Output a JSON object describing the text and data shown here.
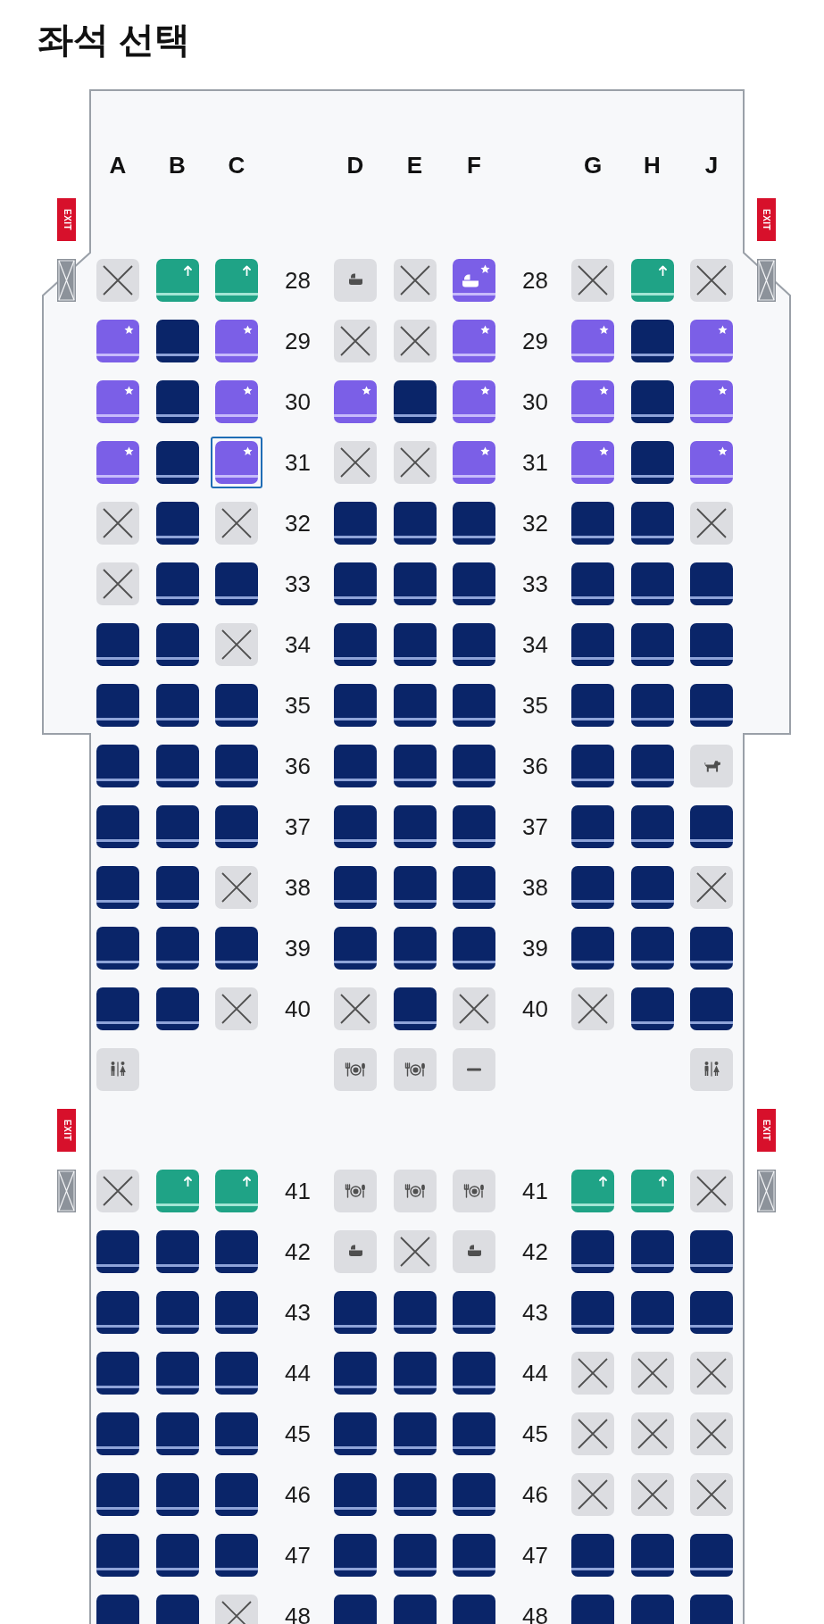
{
  "title": "좌석 선택",
  "cabin": {
    "columns": [
      "A",
      "B",
      "C",
      "D",
      "E",
      "F",
      "G",
      "H",
      "J"
    ],
    "rows": [
      {
        "kind": "exit",
        "signs": [
          "EXIT",
          "EXIT"
        ]
      },
      {
        "kind": "seats",
        "doors": true,
        "labels": [
          "28",
          "28"
        ],
        "seats": [
          {
            "kind": "blocked",
            "selected": false
          },
          {
            "kind": "extra_legroom",
            "selected": false
          },
          {
            "kind": "extra_legroom",
            "selected": false
          },
          {
            "kind": "bassinet"
          },
          {
            "kind": "blocked",
            "selected": false
          },
          {
            "kind": "preferred_bassinet",
            "selected": false
          },
          {
            "kind": "blocked",
            "selected": false
          },
          {
            "kind": "extra_legroom",
            "selected": false
          },
          {
            "kind": "blocked",
            "selected": false
          }
        ]
      },
      {
        "kind": "seats",
        "labels": [
          "29",
          "29"
        ],
        "seats": [
          {
            "kind": "preferred",
            "selected": false
          },
          {
            "kind": "available",
            "selected": false
          },
          {
            "kind": "preferred",
            "selected": false
          },
          {
            "kind": "blocked",
            "selected": false
          },
          {
            "kind": "blocked",
            "selected": false
          },
          {
            "kind": "preferred",
            "selected": false
          },
          {
            "kind": "preferred",
            "selected": false
          },
          {
            "kind": "available",
            "selected": false
          },
          {
            "kind": "preferred",
            "selected": false
          }
        ]
      },
      {
        "kind": "seats",
        "labels": [
          "30",
          "30"
        ],
        "seats": [
          {
            "kind": "preferred",
            "selected": false
          },
          {
            "kind": "available",
            "selected": false
          },
          {
            "kind": "preferred",
            "selected": false
          },
          {
            "kind": "preferred",
            "selected": false
          },
          {
            "kind": "available",
            "selected": false
          },
          {
            "kind": "preferred",
            "selected": false
          },
          {
            "kind": "preferred",
            "selected": false
          },
          {
            "kind": "available",
            "selected": false
          },
          {
            "kind": "preferred",
            "selected": false
          }
        ]
      },
      {
        "kind": "seats",
        "labels": [
          "31",
          "31"
        ],
        "seats": [
          {
            "kind": "preferred",
            "selected": false
          },
          {
            "kind": "available",
            "selected": false
          },
          {
            "kind": "preferred",
            "selected": true
          },
          {
            "kind": "blocked",
            "selected": false
          },
          {
            "kind": "blocked",
            "selected": false
          },
          {
            "kind": "preferred",
            "selected": false
          },
          {
            "kind": "preferred",
            "selected": false
          },
          {
            "kind": "available",
            "selected": false
          },
          {
            "kind": "preferred",
            "selected": false
          }
        ]
      },
      {
        "kind": "seats",
        "labels": [
          "32",
          "32"
        ],
        "seats": [
          {
            "kind": "blocked",
            "selected": false
          },
          {
            "kind": "available",
            "selected": false
          },
          {
            "kind": "blocked",
            "selected": false
          },
          {
            "kind": "available",
            "selected": false
          },
          {
            "kind": "available",
            "selected": false
          },
          {
            "kind": "available",
            "selected": false
          },
          {
            "kind": "available",
            "selected": false
          },
          {
            "kind": "available",
            "selected": false
          },
          {
            "kind": "blocked",
            "selected": false
          }
        ]
      },
      {
        "kind": "seats",
        "labels": [
          "33",
          "33"
        ],
        "seats": [
          {
            "kind": "blocked",
            "selected": false
          },
          {
            "kind": "available",
            "selected": false
          },
          {
            "kind": "available",
            "selected": false
          },
          {
            "kind": "available",
            "selected": false
          },
          {
            "kind": "available",
            "selected": false
          },
          {
            "kind": "available",
            "selected": false
          },
          {
            "kind": "available",
            "selected": false
          },
          {
            "kind": "available",
            "selected": false
          },
          {
            "kind": "available",
            "selected": false
          }
        ]
      },
      {
        "kind": "seats",
        "labels": [
          "34",
          "34"
        ],
        "seats": [
          {
            "kind": "available",
            "selected": false
          },
          {
            "kind": "available",
            "selected": false
          },
          {
            "kind": "blocked",
            "selected": false
          },
          {
            "kind": "available",
            "selected": false
          },
          {
            "kind": "available",
            "selected": false
          },
          {
            "kind": "available",
            "selected": false
          },
          {
            "kind": "available",
            "selected": false
          },
          {
            "kind": "available",
            "selected": false
          },
          {
            "kind": "available",
            "selected": false
          }
        ]
      },
      {
        "kind": "seats",
        "labels": [
          "35",
          "35"
        ],
        "seats": [
          {
            "kind": "available",
            "selected": false
          },
          {
            "kind": "available",
            "selected": false
          },
          {
            "kind": "available",
            "selected": false
          },
          {
            "kind": "available",
            "selected": false
          },
          {
            "kind": "available",
            "selected": false
          },
          {
            "kind": "available",
            "selected": false
          },
          {
            "kind": "available",
            "selected": false
          },
          {
            "kind": "available",
            "selected": false
          },
          {
            "kind": "available",
            "selected": false
          }
        ]
      },
      {
        "kind": "seats",
        "labels": [
          "36",
          "36"
        ],
        "seats": [
          {
            "kind": "available",
            "selected": false
          },
          {
            "kind": "available",
            "selected": false
          },
          {
            "kind": "available",
            "selected": false
          },
          {
            "kind": "available",
            "selected": false
          },
          {
            "kind": "available",
            "selected": false
          },
          {
            "kind": "available",
            "selected": false
          },
          {
            "kind": "available",
            "selected": false
          },
          {
            "kind": "available",
            "selected": false
          },
          {
            "kind": "pet"
          }
        ]
      },
      {
        "kind": "seats",
        "labels": [
          "37",
          "37"
        ],
        "seats": [
          {
            "kind": "available",
            "selected": false
          },
          {
            "kind": "available",
            "selected": false
          },
          {
            "kind": "available",
            "selected": false
          },
          {
            "kind": "available",
            "selected": false
          },
          {
            "kind": "available",
            "selected": false
          },
          {
            "kind": "available",
            "selected": false
          },
          {
            "kind": "available",
            "selected": false
          },
          {
            "kind": "available",
            "selected": false
          },
          {
            "kind": "available",
            "selected": false
          }
        ]
      },
      {
        "kind": "seats",
        "labels": [
          "38",
          "38"
        ],
        "seats": [
          {
            "kind": "available",
            "selected": false
          },
          {
            "kind": "available",
            "selected": false
          },
          {
            "kind": "blocked",
            "selected": false
          },
          {
            "kind": "available",
            "selected": false
          },
          {
            "kind": "available",
            "selected": false
          },
          {
            "kind": "available",
            "selected": false
          },
          {
            "kind": "available",
            "selected": false
          },
          {
            "kind": "available",
            "selected": false
          },
          {
            "kind": "blocked",
            "selected": false
          }
        ]
      },
      {
        "kind": "seats",
        "labels": [
          "39",
          "39"
        ],
        "seats": [
          {
            "kind": "available",
            "selected": false
          },
          {
            "kind": "available",
            "selected": false
          },
          {
            "kind": "available",
            "selected": false
          },
          {
            "kind": "available",
            "selected": false
          },
          {
            "kind": "available",
            "selected": false
          },
          {
            "kind": "available",
            "selected": false
          },
          {
            "kind": "available",
            "selected": false
          },
          {
            "kind": "available",
            "selected": false
          },
          {
            "kind": "available",
            "selected": false
          }
        ]
      },
      {
        "kind": "seats",
        "labels": [
          "40",
          "40"
        ],
        "seats": [
          {
            "kind": "available",
            "selected": false
          },
          {
            "kind": "available",
            "selected": false
          },
          {
            "kind": "blocked",
            "selected": false
          },
          {
            "kind": "blocked",
            "selected": false
          },
          {
            "kind": "available",
            "selected": false
          },
          {
            "kind": "blocked",
            "selected": false
          },
          {
            "kind": "blocked",
            "selected": false
          },
          {
            "kind": "available",
            "selected": false
          },
          {
            "kind": "available",
            "selected": false
          }
        ]
      },
      {
        "kind": "facilities",
        "cells": [
          {
            "kind": "lavatory"
          },
          {
            "kind": "empty"
          },
          {
            "kind": "empty"
          },
          {
            "kind": "galley"
          },
          {
            "kind": "galley"
          },
          {
            "kind": "closed"
          },
          {
            "kind": "empty"
          },
          {
            "kind": "empty"
          },
          {
            "kind": "lavatory"
          }
        ]
      },
      {
        "kind": "exit",
        "signs": [
          "EXIT",
          "EXIT"
        ]
      },
      {
        "kind": "seats",
        "doors": true,
        "labels": [
          "41",
          "41"
        ],
        "seats": [
          {
            "kind": "blocked",
            "selected": false
          },
          {
            "kind": "extra_legroom",
            "selected": false
          },
          {
            "kind": "extra_legroom",
            "selected": false
          },
          {
            "kind": "galley"
          },
          {
            "kind": "galley"
          },
          {
            "kind": "galley"
          },
          {
            "kind": "extra_legroom",
            "selected": false
          },
          {
            "kind": "extra_legroom",
            "selected": false
          },
          {
            "kind": "blocked",
            "selected": false
          }
        ]
      },
      {
        "kind": "seats",
        "labels": [
          "42",
          "42"
        ],
        "seats": [
          {
            "kind": "available",
            "selected": false
          },
          {
            "kind": "available",
            "selected": false
          },
          {
            "kind": "available",
            "selected": false
          },
          {
            "kind": "bassinet"
          },
          {
            "kind": "blocked",
            "selected": false
          },
          {
            "kind": "bassinet"
          },
          {
            "kind": "available",
            "selected": false
          },
          {
            "kind": "available",
            "selected": false
          },
          {
            "kind": "available",
            "selected": false
          }
        ]
      },
      {
        "kind": "seats",
        "labels": [
          "43",
          "43"
        ],
        "seats": [
          {
            "kind": "available",
            "selected": false
          },
          {
            "kind": "available",
            "selected": false
          },
          {
            "kind": "available",
            "selected": false
          },
          {
            "kind": "available",
            "selected": false
          },
          {
            "kind": "available",
            "selected": false
          },
          {
            "kind": "available",
            "selected": false
          },
          {
            "kind": "available",
            "selected": false
          },
          {
            "kind": "available",
            "selected": false
          },
          {
            "kind": "available",
            "selected": false
          }
        ]
      },
      {
        "kind": "seats",
        "labels": [
          "44",
          "44"
        ],
        "seats": [
          {
            "kind": "available",
            "selected": false
          },
          {
            "kind": "available",
            "selected": false
          },
          {
            "kind": "available",
            "selected": false
          },
          {
            "kind": "available",
            "selected": false
          },
          {
            "kind": "available",
            "selected": false
          },
          {
            "kind": "available",
            "selected": false
          },
          {
            "kind": "blocked",
            "selected": false
          },
          {
            "kind": "blocked",
            "selected": false
          },
          {
            "kind": "blocked",
            "selected": false
          }
        ]
      },
      {
        "kind": "seats",
        "labels": [
          "45",
          "45"
        ],
        "seats": [
          {
            "kind": "available",
            "selected": false
          },
          {
            "kind": "available",
            "selected": false
          },
          {
            "kind": "available",
            "selected": false
          },
          {
            "kind": "available",
            "selected": false
          },
          {
            "kind": "available",
            "selected": false
          },
          {
            "kind": "available",
            "selected": false
          },
          {
            "kind": "blocked",
            "selected": false
          },
          {
            "kind": "blocked",
            "selected": false
          },
          {
            "kind": "blocked",
            "selected": false
          }
        ]
      },
      {
        "kind": "seats",
        "labels": [
          "46",
          "46"
        ],
        "seats": [
          {
            "kind": "available",
            "selected": false
          },
          {
            "kind": "available",
            "selected": false
          },
          {
            "kind": "available",
            "selected": false
          },
          {
            "kind": "available",
            "selected": false
          },
          {
            "kind": "available",
            "selected": false
          },
          {
            "kind": "available",
            "selected": false
          },
          {
            "kind": "blocked",
            "selected": false
          },
          {
            "kind": "blocked",
            "selected": false
          },
          {
            "kind": "blocked",
            "selected": false
          }
        ]
      },
      {
        "kind": "seats",
        "labels": [
          "47",
          "47"
        ],
        "seats": [
          {
            "kind": "available",
            "selected": false
          },
          {
            "kind": "available",
            "selected": false
          },
          {
            "kind": "available",
            "selected": false
          },
          {
            "kind": "available",
            "selected": false
          },
          {
            "kind": "available",
            "selected": false
          },
          {
            "kind": "available",
            "selected": false
          },
          {
            "kind": "available",
            "selected": false
          },
          {
            "kind": "available",
            "selected": false
          },
          {
            "kind": "available",
            "selected": false
          }
        ]
      },
      {
        "kind": "seats",
        "labels": [
          "48",
          "48"
        ],
        "seats": [
          {
            "kind": "available",
            "selected": false
          },
          {
            "kind": "available",
            "selected": false
          },
          {
            "kind": "blocked",
            "selected": false
          },
          {
            "kind": "available",
            "selected": false
          },
          {
            "kind": "available",
            "selected": false
          },
          {
            "kind": "available",
            "selected": false
          },
          {
            "kind": "available",
            "selected": false
          },
          {
            "kind": "available",
            "selected": false
          },
          {
            "kind": "available",
            "selected": false
          }
        ]
      }
    ]
  }
}
